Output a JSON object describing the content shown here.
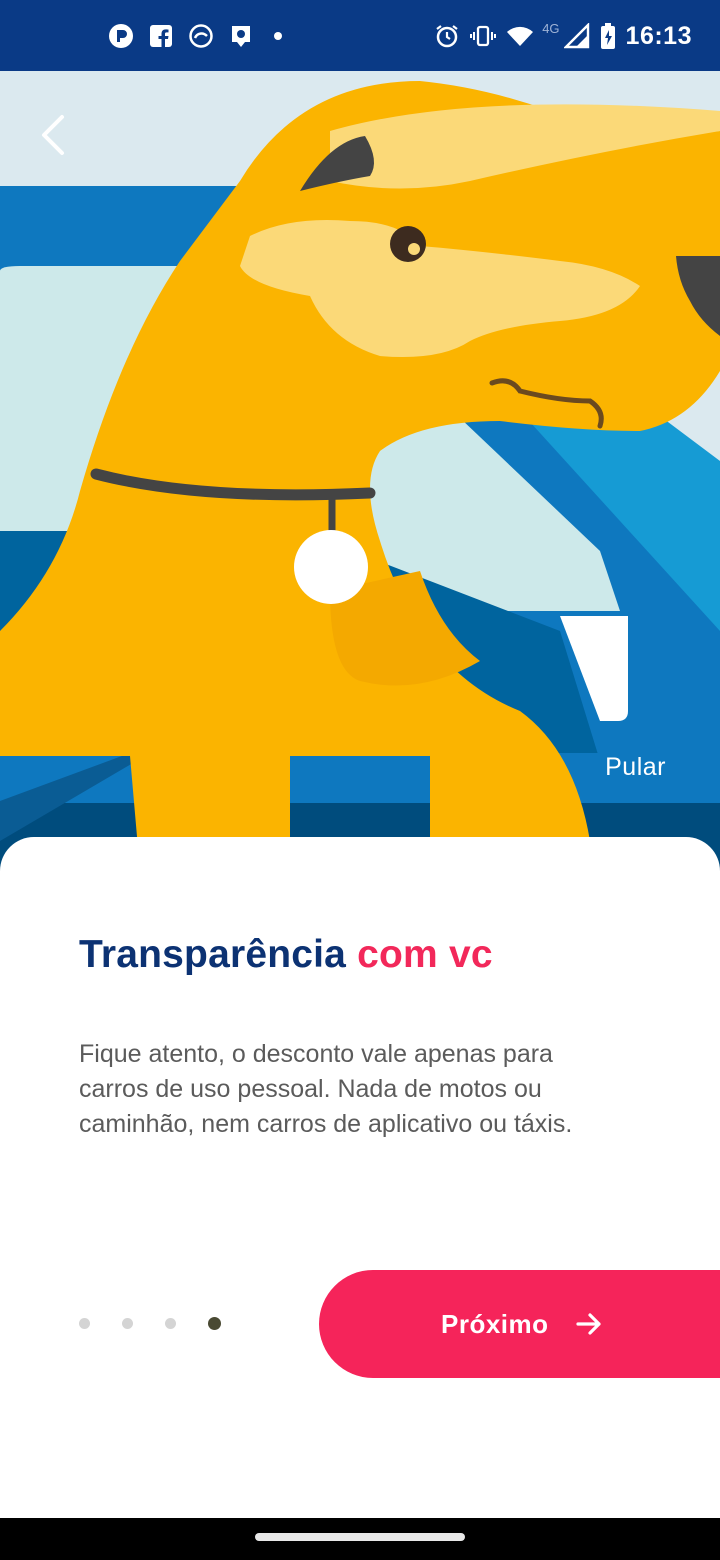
{
  "status_bar": {
    "time": "16:13",
    "network": "4G",
    "left_icons": [
      "app-notification-icon",
      "facebook-icon",
      "sync-icon",
      "location-pin-icon",
      "dot-icon"
    ],
    "right_icons": [
      "alarm-icon",
      "vibrate-icon",
      "wifi-icon",
      "signal-icon",
      "battery-charging-icon"
    ]
  },
  "hero": {
    "back_icon": "chevron-left-icon",
    "skip_label": "Pular"
  },
  "content": {
    "title_main": "Transparência",
    "title_accent": "com vc",
    "body": "Fique atento, o desconto vale apenas para carros de uso pessoal. Nada de motos ou caminhão, nem carros de aplicativo ou táxis."
  },
  "pagination": {
    "total": 4,
    "active_index": 3
  },
  "next_button": {
    "label": "Próximo",
    "icon": "arrow-right-icon"
  },
  "colors": {
    "status_bar": "#0a3a86",
    "title": "#0c3273",
    "accent": "#f2285a",
    "button": "#f5245a",
    "dog": "#fbb400",
    "dog_light": "#fbd978"
  }
}
